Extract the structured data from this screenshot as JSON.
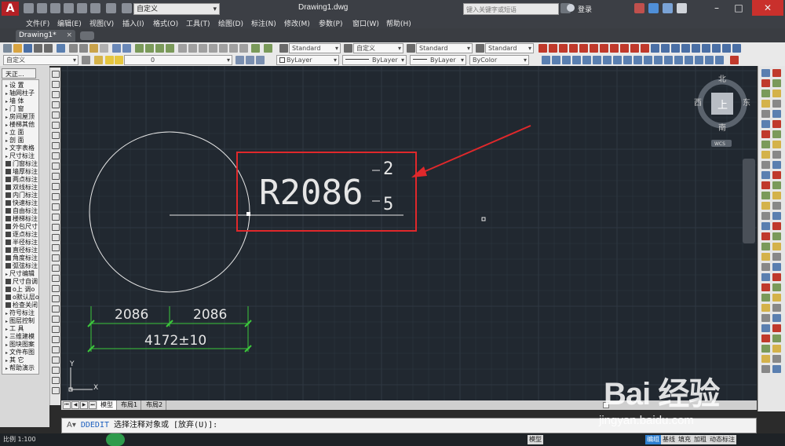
{
  "titlebar": {
    "doc_title": "Drawing1.dwg",
    "workspace": "自定义",
    "search_placeholder": "键入关键字或短语",
    "login_label": "登录"
  },
  "menu": [
    "文件(F)",
    "编辑(E)",
    "视图(V)",
    "插入(I)",
    "格式(O)",
    "工具(T)",
    "绘图(D)",
    "标注(N)",
    "修改(M)",
    "参数(P)",
    "窗口(W)",
    "帮助(H)"
  ],
  "file_tab": {
    "label": "Drawing1*"
  },
  "toolbar1": {
    "text_style": "Standard",
    "dim_style": "自定义",
    "table_style": "Standard",
    "mleader_style": "Standard"
  },
  "toolbar2": {
    "workspace": "自定义",
    "layer": "0",
    "color": "ByLayer",
    "linetype": "ByLayer",
    "lineweight": "ByLayer",
    "plotstyle": "ByColor"
  },
  "palette": {
    "title": "天正...",
    "items": [
      {
        "label": "设    置",
        "kind": "tri"
      },
      {
        "label": "轴网柱子",
        "kind": "tri"
      },
      {
        "label": "墙    体",
        "kind": "tri"
      },
      {
        "label": "门    窗",
        "kind": "tri"
      },
      {
        "label": "房间屋顶",
        "kind": "tri"
      },
      {
        "label": "楼梯其他",
        "kind": "tri"
      },
      {
        "label": "立    面",
        "kind": "tri"
      },
      {
        "label": "剖    面",
        "kind": "tri"
      },
      {
        "label": "文字表格",
        "kind": "tri"
      },
      {
        "label": "尺寸标注",
        "kind": "tri"
      },
      {
        "label": "门窗标注",
        "kind": "ico"
      },
      {
        "label": "墙厚标注",
        "kind": "ico"
      },
      {
        "label": "两点标注",
        "kind": "ico"
      },
      {
        "label": "双线标注",
        "kind": "ico"
      },
      {
        "label": "内门标注",
        "kind": "ico"
      },
      {
        "label": "快速标注",
        "kind": "ico"
      },
      {
        "label": "自由标注",
        "kind": "ico"
      },
      {
        "label": "楼梯标注",
        "kind": "ico"
      },
      {
        "label": "外包尺寸",
        "kind": "ico"
      },
      {
        "label": "逐点标注",
        "kind": "ico"
      },
      {
        "label": "半径标注",
        "kind": "ico"
      },
      {
        "label": "直径标注",
        "kind": "ico"
      },
      {
        "label": "角度标注",
        "kind": "ico"
      },
      {
        "label": "弧弦标注",
        "kind": "ico"
      },
      {
        "label": "尺寸编辑",
        "kind": "tri"
      },
      {
        "label": "尺寸自调",
        "kind": "ico"
      },
      {
        "label": "o上  调o",
        "kind": "ico"
      },
      {
        "label": "o默认层o",
        "kind": "ico"
      },
      {
        "label": "检查关闭",
        "kind": "ico"
      },
      {
        "label": "符号标注",
        "kind": "tri"
      },
      {
        "label": "图层控制",
        "kind": "tri"
      },
      {
        "label": "工    具",
        "kind": "tri"
      },
      {
        "label": "三维建模",
        "kind": "tri"
      },
      {
        "label": "图块图案",
        "kind": "tri"
      },
      {
        "label": "文件布图",
        "kind": "tri"
      },
      {
        "label": "其    它",
        "kind": "tri"
      },
      {
        "label": "帮助演示",
        "kind": "tri"
      }
    ]
  },
  "viewcube": {
    "north": "北",
    "south": "南",
    "east": "东",
    "west": "西",
    "top_face": "上",
    "wcs": "WCS"
  },
  "drawing": {
    "radius_dim_text": "R2086",
    "stack_top": "2",
    "stack_bottom": "5",
    "dim_left": "2086",
    "dim_right": "2086",
    "dim_total": "4172±10",
    "ucs_x": "X",
    "ucs_y": "Y",
    "colors": {
      "background": "#212830",
      "grid": "#2f3842",
      "highlight": "#e0282b",
      "dimension": "#3cc83c",
      "geometry": "#e6e6e6"
    }
  },
  "layout_tabs": [
    "模型",
    "布局1",
    "布局2"
  ],
  "command": {
    "keyword": "DDEDIT",
    "text": " 选择注释对象或 [放弃(U)]:"
  },
  "status": {
    "scale": "比例 1:100",
    "items": [
      "模型",
      "编组",
      "基线",
      "填充",
      "加粗",
      "动态标注"
    ],
    "active_item": "编组"
  },
  "watermark": {
    "text": "Bai 经验",
    "url": "jingyan.baidu.com"
  }
}
